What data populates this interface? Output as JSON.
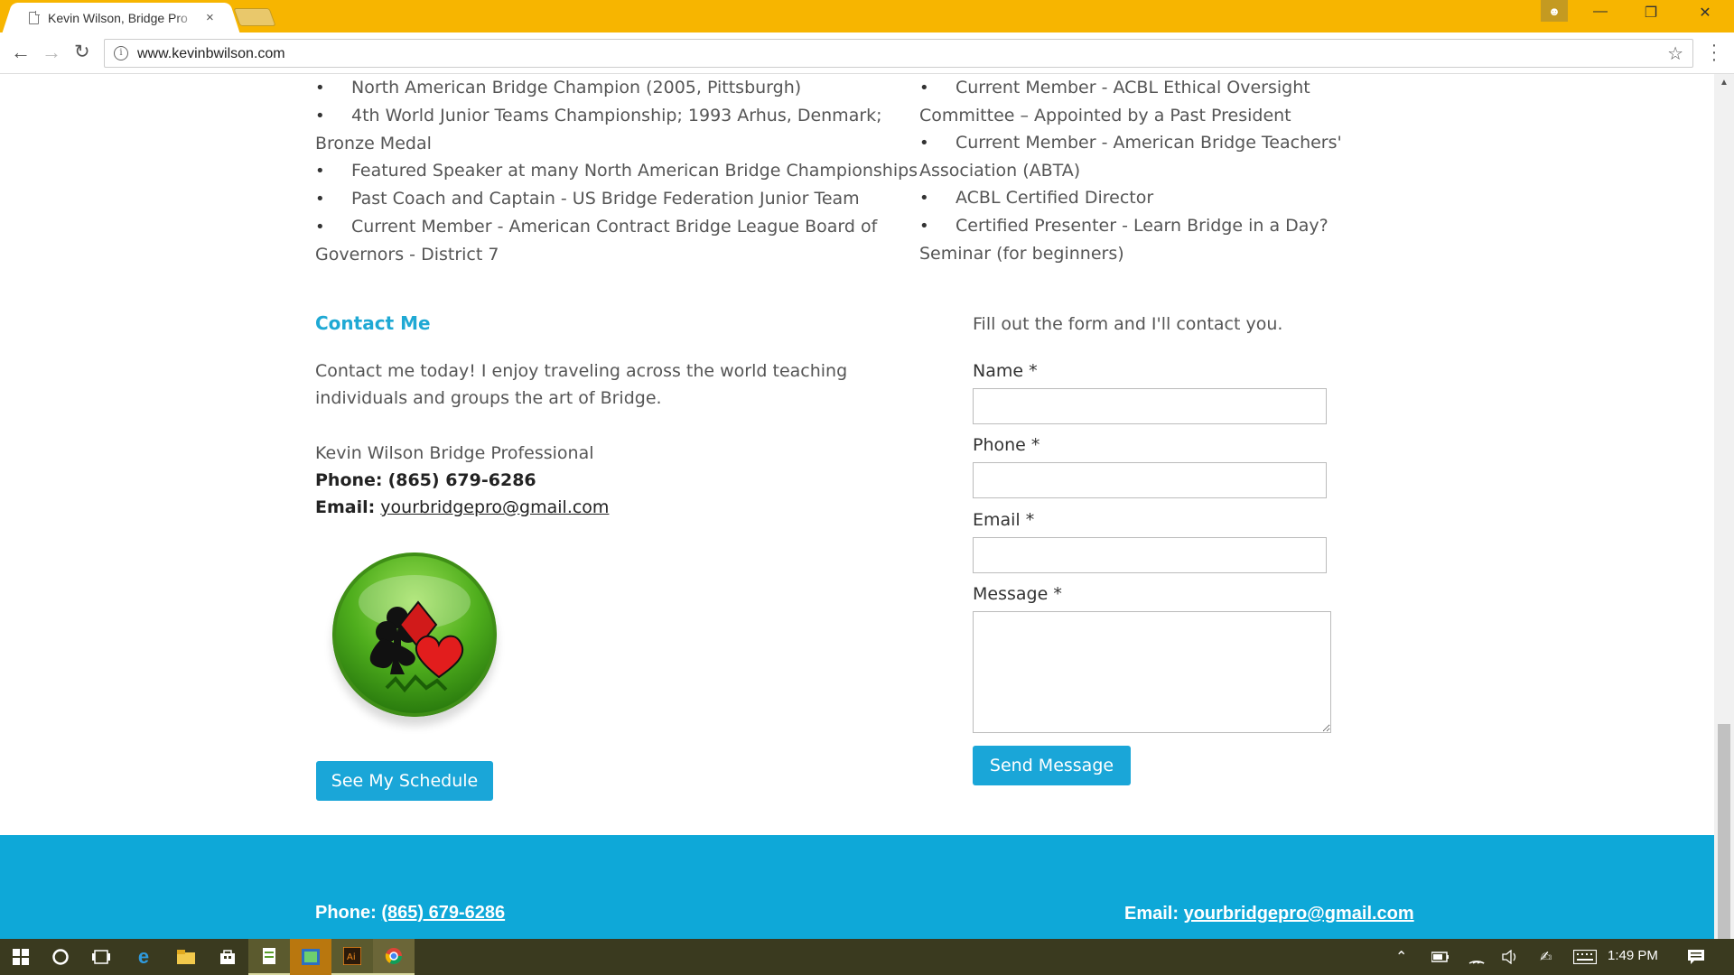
{
  "browser": {
    "tab_title": "Kevin Wilson, Bridge Pro",
    "tab_close": "×",
    "url": "www.kevinbwilson.com"
  },
  "left_list": [
    "North American Bridge Champion (2005, Pittsburgh)",
    "4th World Junior Teams Championship; 1993 Arhus, Denmark; Bronze Medal",
    "Featured Speaker at many North American Bridge Championships",
    "Past Coach and Captain - US Bridge Federation Junior Team",
    "Current Member - American Contract Bridge League Board of Governors - District 7"
  ],
  "right_list": [
    "Current Member - ACBL Ethical Oversight Committee – Appointed by a Past President",
    "Current Member - American Bridge Teachers' Association (ABTA)",
    "ACBL Certified Director",
    "Certified Presenter - Learn Bridge in a Day? Seminar (for beginners)"
  ],
  "contact": {
    "heading": "Contact Me",
    "intro": "Contact me today! I enjoy traveling across the world teaching individuals and groups the art of Bridge.",
    "name_line": "Kevin Wilson Bridge Professional",
    "phone_label": "Phone:",
    "phone_value": "(865) 679-6286",
    "email_label": "Email:",
    "email_value": "yourbridgepro@gmail.com",
    "schedule_button": "See My Schedule"
  },
  "form": {
    "intro": "Fill out the form and I'll contact you.",
    "name_label": "Name *",
    "phone_label": "Phone *",
    "email_label": "Email *",
    "message_label": "Message *",
    "send_button": "Send Message"
  },
  "footer": {
    "phone_label": "Phone:",
    "phone_value": "(865) 679-6286",
    "email_label": "Email:",
    "email_value": "yourbridgepro@gmail.com"
  },
  "taskbar": {
    "time": "1:49 PM"
  },
  "colors": {
    "accent": "#1aa6d8",
    "chrome_frame": "#f7b500",
    "footer_bg": "#0ea8d8"
  }
}
